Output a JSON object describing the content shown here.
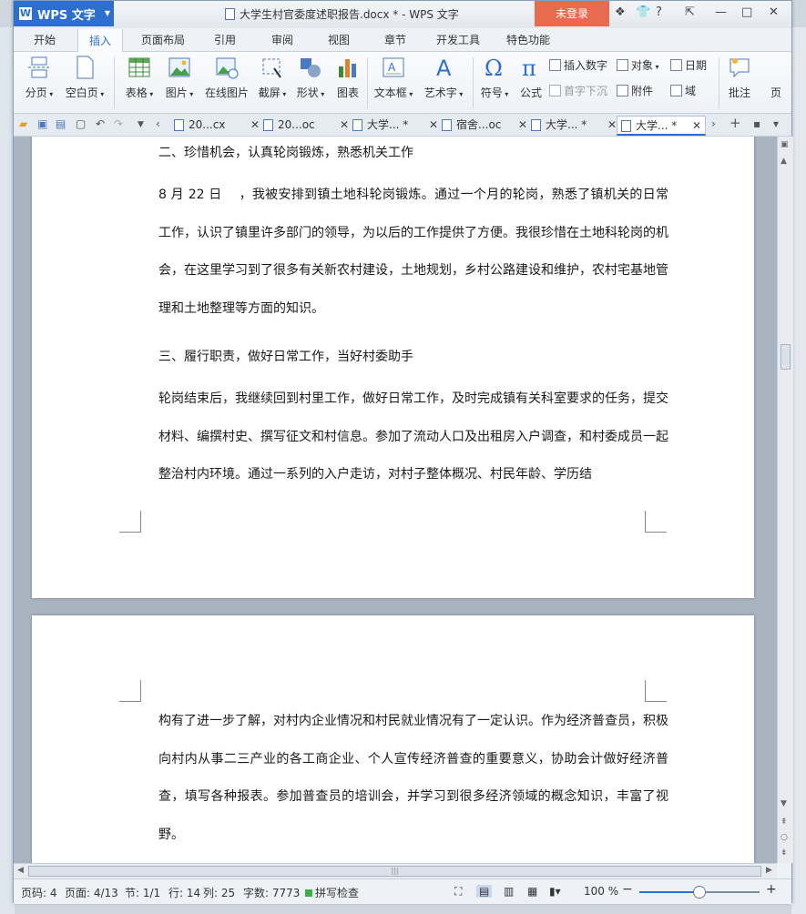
{
  "window": {
    "app_button": "WPS 文字",
    "document_title": "大学生村官委度述职报告.docx * - WPS 文字",
    "login_label": "未登录",
    "controls": {
      "skin": "❖",
      "shirt": "👕",
      "help": "?",
      "collapse": "⇱",
      "minimize": "—",
      "maximize": "□",
      "close": "✕"
    }
  },
  "menu_tabs": [
    "开始",
    "插入",
    "页面布局",
    "引用",
    "审阅",
    "视图",
    "章节",
    "开发工具",
    "特色功能"
  ],
  "active_menu_tab": "插入",
  "ribbon": {
    "page_break": "分页",
    "blank_page": "空白页",
    "table": "表格",
    "picture": "图片",
    "online_picture": "在线图片",
    "screenshot": "截屏",
    "shapes": "形状",
    "chart": "图表",
    "textbox": "文本框",
    "wordart": "艺术字",
    "symbol": "符号",
    "formula": "公式",
    "insert_number": "插入数字",
    "drop_cap": "首字下沉",
    "object": "对象",
    "attachment": "附件",
    "date": "日期",
    "field": "域",
    "comment": "批注",
    "page_more": "页"
  },
  "doc_tabs": [
    {
      "label": "20...cx",
      "active": false
    },
    {
      "label": "20...oc",
      "active": false
    },
    {
      "label": "大学... *",
      "active": false
    },
    {
      "label": "宿舍...oc",
      "active": false
    },
    {
      "label": "大学... *",
      "active": false
    },
    {
      "label": "大学... *",
      "active": true
    }
  ],
  "document": {
    "heading2": "二、珍惜机会，认真轮岗锻炼，熟悉机关工作",
    "para1": "8 月 22 日 　，我被安排到镇土地科轮岗锻炼。通过一个月的轮岗，熟悉了镇机关的日常工作，认识了镇里许多部门的领导，为以后的工作提供了方便。我很珍惜在土地科轮岗的机会，在这里学习到了很多有关新农村建设，土地规划，乡村公路建设和维护，农村宅基地管理和土地整理等方面的知识。",
    "heading3": "三、履行职责，做好日常工作，当好村委助手",
    "para2": "轮岗结束后，我继续回到村里工作，做好日常工作，及时完成镇有关科室要求的任务，提交材料、编撰村史、撰写征文和村信息。参加了流动人口及出租房入户调查，和村委成员一起整治村内环境。通过一系列的入户走访，对村子整体概况、村民年龄、学历结",
    "para3": "构有了进一步了解，对村内企业情况和村民就业情况有了一定认识。作为经济普查员，积极向村内从事二三产业的各工商企业、个人宣传经济普查的重要意义，协助会计做好经济普查，填写各种报表。参加普查员的培训会，并学习到很多经济领域的概念知识，丰富了视野。"
  },
  "status": {
    "page_code": "页码: 4",
    "pages": "页面: 4/13",
    "section": "节: 1/1",
    "row": "行: 14",
    "col": "列: 25",
    "word_count": "字数: 7773",
    "spell_check": "拼写检查",
    "zoom": "100 %",
    "zoom_level": 0.5
  },
  "colors": {
    "accent": "#2d6fd1",
    "login": "#e86b4f"
  }
}
